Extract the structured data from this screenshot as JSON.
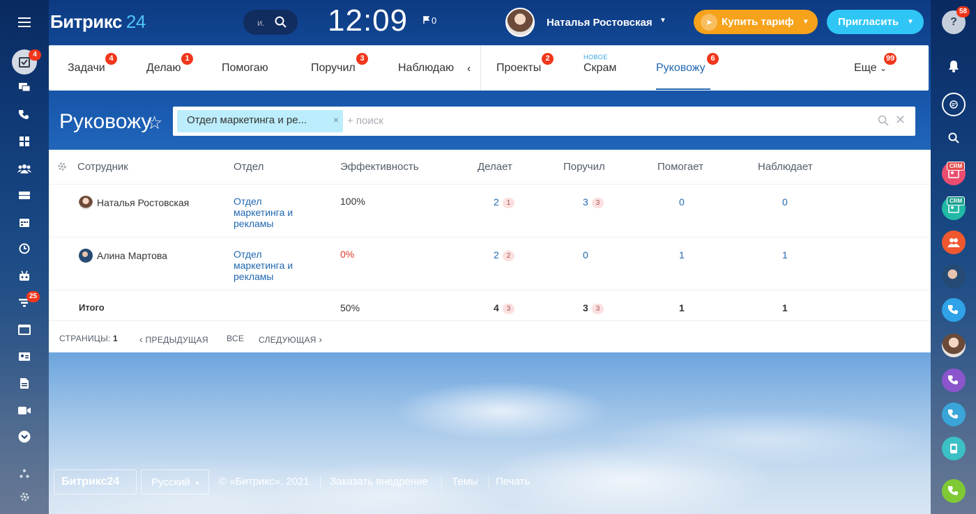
{
  "header": {
    "logo_name": "Битрикс",
    "logo_num": "24",
    "search_placeholder": "и.",
    "clock": "12:09",
    "flag_count": "0",
    "user_name": "Наталья Ростовская",
    "buy_label": "Купить тариф",
    "invite_label": "Пригласить"
  },
  "left_sidebar": {
    "tasks_badge": "4",
    "funnel_badge": "25"
  },
  "right_sidebar": {
    "help_badge": "58",
    "crm_label_1": "CRM",
    "crm_label_2": "CRM"
  },
  "tabs": [
    {
      "label": "Задачи",
      "badge": "4"
    },
    {
      "label": "Делаю",
      "badge": "1"
    },
    {
      "label": "Помогаю",
      "badge": ""
    },
    {
      "label": "Поручил",
      "badge": "3"
    },
    {
      "label": "Наблюдаю",
      "badge": ""
    },
    {
      "label": "Проекты",
      "badge": "2"
    },
    {
      "label": "Скрам",
      "badge": "",
      "tag": "НОВОЕ"
    },
    {
      "label": "Руковожу",
      "badge": "6",
      "active": true
    },
    {
      "label": "Еще",
      "badge": "99"
    }
  ],
  "page": {
    "title": "Руковожу"
  },
  "filter": {
    "chip": "Отдел маркетинга и ре...",
    "placeholder": "+ поиск"
  },
  "table": {
    "columns": [
      "Сотрудник",
      "Отдел",
      "Эффективность",
      "Делает",
      "Поручил",
      "Помогает",
      "Наблюдает"
    ],
    "rows": [
      {
        "employee": "Наталья Ростовская",
        "dept_lines": [
          "Отдел",
          "маркетинга и",
          "рекламы"
        ],
        "efficiency": "100%",
        "doing": "2",
        "doing_pill": "1",
        "assigned": "3",
        "assigned_pill": "3",
        "helping": "0",
        "watching": "0"
      },
      {
        "employee": "Алина Мартова",
        "dept_lines": [
          "Отдел",
          "маркетинга и",
          "рекламы"
        ],
        "efficiency": "0%",
        "doing": "2",
        "doing_pill": "2",
        "assigned": "0",
        "assigned_pill": "",
        "helping": "1",
        "watching": "1"
      }
    ],
    "total": {
      "label": "Итого",
      "efficiency": "50%",
      "doing": "4",
      "doing_pill": "3",
      "assigned": "3",
      "assigned_pill": "3",
      "helping": "1",
      "watching": "1"
    }
  },
  "pager": {
    "pages_label": "СТРАНИЦЫ:",
    "page": "1",
    "prev": "ПРЕДЫДУЩАЯ",
    "all": "ВСЕ",
    "next": "СЛЕДУЮЩАЯ"
  },
  "footer": {
    "logo": "Битрикс24",
    "language": "Русский",
    "copyright": "© «Битрикс», 2021",
    "order": "Заказать внедрение",
    "themes": "Темы",
    "print": "Печать"
  },
  "colors": {
    "accent": "#2067b0",
    "badge": "#f1361b",
    "buy": "#f6a21b",
    "invite": "#2fc6f6",
    "negative": "#e0382b"
  }
}
